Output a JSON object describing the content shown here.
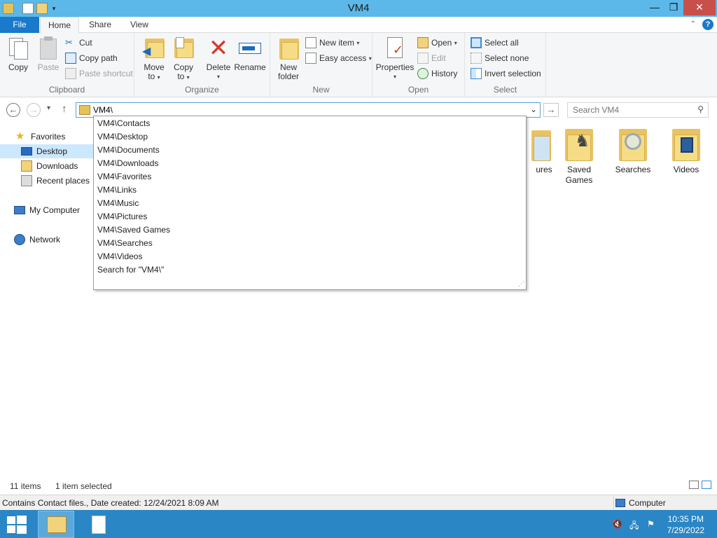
{
  "window": {
    "title": "VM4"
  },
  "window_controls": {
    "minimize": "—",
    "restore": "❐",
    "close": "✕"
  },
  "ribbon_tabs": {
    "file": "File",
    "home": "Home",
    "share": "Share",
    "view": "View",
    "help": "?"
  },
  "clipboard": {
    "copy": "Copy",
    "paste": "Paste",
    "cut": "Cut",
    "copy_path": "Copy path",
    "paste_shortcut": "Paste shortcut",
    "group": "Clipboard"
  },
  "organize": {
    "move_to": [
      "Move",
      "to"
    ],
    "copy_to": [
      "Copy",
      "to"
    ],
    "delete": "Delete",
    "rename": "Rename",
    "group": "Organize"
  },
  "new": {
    "new_folder": [
      "New",
      "folder"
    ],
    "new_item": "New item",
    "easy_access": "Easy access",
    "group": "New"
  },
  "open": {
    "properties": "Properties",
    "open": "Open",
    "edit": "Edit",
    "history": "History",
    "group": "Open"
  },
  "select": {
    "select_all": "Select all",
    "select_none": "Select none",
    "invert_selection": "Invert selection",
    "group": "Select"
  },
  "address": {
    "value": "VM4\\"
  },
  "search": {
    "placeholder": "Search VM4"
  },
  "nav_pane": {
    "favorites": "Favorites",
    "desktop": "Desktop",
    "downloads": "Downloads",
    "recent_places": "Recent places",
    "my_computer": "My Computer",
    "network": "Network"
  },
  "items": {
    "pictures_partial": "ures",
    "saved_games": [
      "Saved",
      "Games"
    ],
    "searches": "Searches",
    "videos": "Videos"
  },
  "suggestions": [
    "VM4\\Contacts",
    "VM4\\Desktop",
    "VM4\\Documents",
    "VM4\\Downloads",
    "VM4\\Favorites",
    "VM4\\Links",
    "VM4\\Music",
    "VM4\\Pictures",
    "VM4\\Saved Games",
    "VM4\\Searches",
    "VM4\\Videos",
    "Search for \"VM4\\\""
  ],
  "status": {
    "item_count": "11 items",
    "selected": "1 item selected",
    "details": "Contains Contact files., Date created: 12/24/2021 8:09 AM",
    "location": "Computer"
  },
  "taskbar": {
    "time": "10:35 PM",
    "date": "7/29/2022"
  },
  "colors": {
    "titlebar": "#5bb8e9",
    "file_tab": "#1979ca",
    "taskbar": "#2a86c5",
    "selection": "#cce8ff"
  }
}
